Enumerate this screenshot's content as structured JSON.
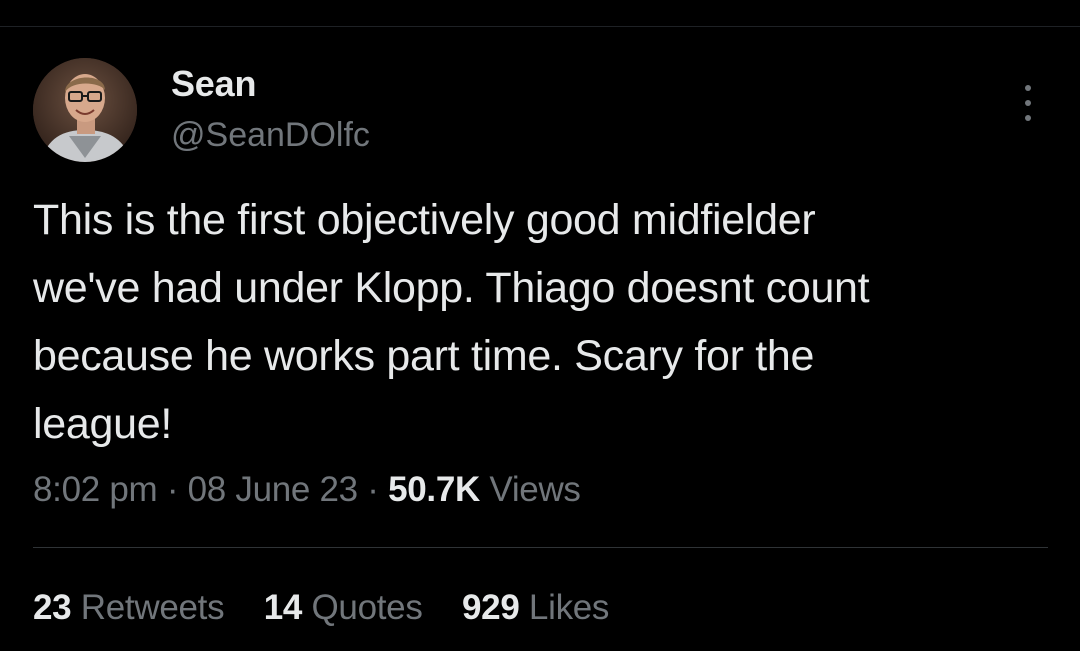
{
  "author": {
    "display_name": "Sean",
    "handle": "@SeanDOlfc",
    "avatar_icon": "user-avatar-photo"
  },
  "menu": {
    "icon": "more-vertical-icon"
  },
  "tweet": {
    "text": "This is the first objectively good midfielder\nwe've had under Klopp. Thiago doesnt count\nbecause he works part time. Scary for the\nleague!"
  },
  "meta": {
    "time": "8:02 pm",
    "separator": "·",
    "date": "08 June 23",
    "views_count": "50.7K",
    "views_label": "Views"
  },
  "stats": {
    "retweets": {
      "count": "23",
      "label": "Retweets"
    },
    "quotes": {
      "count": "14",
      "label": "Quotes"
    },
    "likes": {
      "count": "929",
      "label": "Likes"
    }
  },
  "colors": {
    "background": "#000000",
    "primary_text": "#e7e9ea",
    "secondary_text": "#71767b",
    "divider": "#2f3336"
  }
}
